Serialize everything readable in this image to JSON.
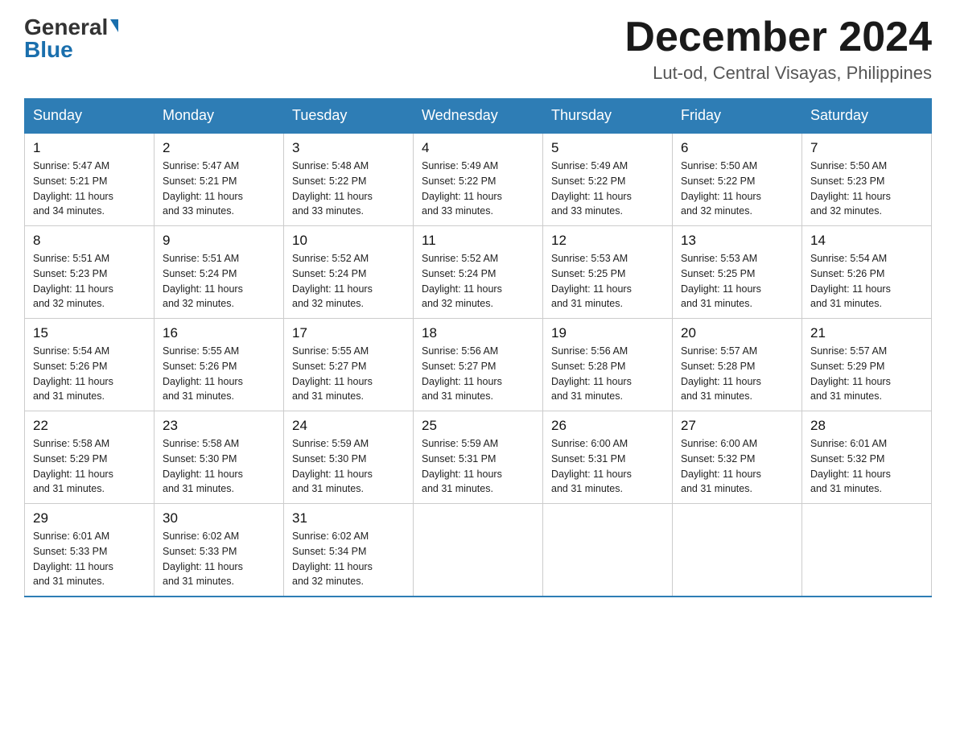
{
  "header": {
    "logo_general": "General",
    "logo_blue": "Blue",
    "month_title": "December 2024",
    "location": "Lut-od, Central Visayas, Philippines"
  },
  "days_of_week": [
    "Sunday",
    "Monday",
    "Tuesday",
    "Wednesday",
    "Thursday",
    "Friday",
    "Saturday"
  ],
  "weeks": [
    [
      {
        "day": "1",
        "sunrise": "5:47 AM",
        "sunset": "5:21 PM",
        "daylight": "11 hours and 34 minutes."
      },
      {
        "day": "2",
        "sunrise": "5:47 AM",
        "sunset": "5:21 PM",
        "daylight": "11 hours and 33 minutes."
      },
      {
        "day": "3",
        "sunrise": "5:48 AM",
        "sunset": "5:22 PM",
        "daylight": "11 hours and 33 minutes."
      },
      {
        "day": "4",
        "sunrise": "5:49 AM",
        "sunset": "5:22 PM",
        "daylight": "11 hours and 33 minutes."
      },
      {
        "day": "5",
        "sunrise": "5:49 AM",
        "sunset": "5:22 PM",
        "daylight": "11 hours and 33 minutes."
      },
      {
        "day": "6",
        "sunrise": "5:50 AM",
        "sunset": "5:22 PM",
        "daylight": "11 hours and 32 minutes."
      },
      {
        "day": "7",
        "sunrise": "5:50 AM",
        "sunset": "5:23 PM",
        "daylight": "11 hours and 32 minutes."
      }
    ],
    [
      {
        "day": "8",
        "sunrise": "5:51 AM",
        "sunset": "5:23 PM",
        "daylight": "11 hours and 32 minutes."
      },
      {
        "day": "9",
        "sunrise": "5:51 AM",
        "sunset": "5:24 PM",
        "daylight": "11 hours and 32 minutes."
      },
      {
        "day": "10",
        "sunrise": "5:52 AM",
        "sunset": "5:24 PM",
        "daylight": "11 hours and 32 minutes."
      },
      {
        "day": "11",
        "sunrise": "5:52 AM",
        "sunset": "5:24 PM",
        "daylight": "11 hours and 32 minutes."
      },
      {
        "day": "12",
        "sunrise": "5:53 AM",
        "sunset": "5:25 PM",
        "daylight": "11 hours and 31 minutes."
      },
      {
        "day": "13",
        "sunrise": "5:53 AM",
        "sunset": "5:25 PM",
        "daylight": "11 hours and 31 minutes."
      },
      {
        "day": "14",
        "sunrise": "5:54 AM",
        "sunset": "5:26 PM",
        "daylight": "11 hours and 31 minutes."
      }
    ],
    [
      {
        "day": "15",
        "sunrise": "5:54 AM",
        "sunset": "5:26 PM",
        "daylight": "11 hours and 31 minutes."
      },
      {
        "day": "16",
        "sunrise": "5:55 AM",
        "sunset": "5:26 PM",
        "daylight": "11 hours and 31 minutes."
      },
      {
        "day": "17",
        "sunrise": "5:55 AM",
        "sunset": "5:27 PM",
        "daylight": "11 hours and 31 minutes."
      },
      {
        "day": "18",
        "sunrise": "5:56 AM",
        "sunset": "5:27 PM",
        "daylight": "11 hours and 31 minutes."
      },
      {
        "day": "19",
        "sunrise": "5:56 AM",
        "sunset": "5:28 PM",
        "daylight": "11 hours and 31 minutes."
      },
      {
        "day": "20",
        "sunrise": "5:57 AM",
        "sunset": "5:28 PM",
        "daylight": "11 hours and 31 minutes."
      },
      {
        "day": "21",
        "sunrise": "5:57 AM",
        "sunset": "5:29 PM",
        "daylight": "11 hours and 31 minutes."
      }
    ],
    [
      {
        "day": "22",
        "sunrise": "5:58 AM",
        "sunset": "5:29 PM",
        "daylight": "11 hours and 31 minutes."
      },
      {
        "day": "23",
        "sunrise": "5:58 AM",
        "sunset": "5:30 PM",
        "daylight": "11 hours and 31 minutes."
      },
      {
        "day": "24",
        "sunrise": "5:59 AM",
        "sunset": "5:30 PM",
        "daylight": "11 hours and 31 minutes."
      },
      {
        "day": "25",
        "sunrise": "5:59 AM",
        "sunset": "5:31 PM",
        "daylight": "11 hours and 31 minutes."
      },
      {
        "day": "26",
        "sunrise": "6:00 AM",
        "sunset": "5:31 PM",
        "daylight": "11 hours and 31 minutes."
      },
      {
        "day": "27",
        "sunrise": "6:00 AM",
        "sunset": "5:32 PM",
        "daylight": "11 hours and 31 minutes."
      },
      {
        "day": "28",
        "sunrise": "6:01 AM",
        "sunset": "5:32 PM",
        "daylight": "11 hours and 31 minutes."
      }
    ],
    [
      {
        "day": "29",
        "sunrise": "6:01 AM",
        "sunset": "5:33 PM",
        "daylight": "11 hours and 31 minutes."
      },
      {
        "day": "30",
        "sunrise": "6:02 AM",
        "sunset": "5:33 PM",
        "daylight": "11 hours and 31 minutes."
      },
      {
        "day": "31",
        "sunrise": "6:02 AM",
        "sunset": "5:34 PM",
        "daylight": "11 hours and 32 minutes."
      },
      null,
      null,
      null,
      null
    ]
  ],
  "labels": {
    "sunrise": "Sunrise:",
    "sunset": "Sunset:",
    "daylight": "Daylight:"
  }
}
